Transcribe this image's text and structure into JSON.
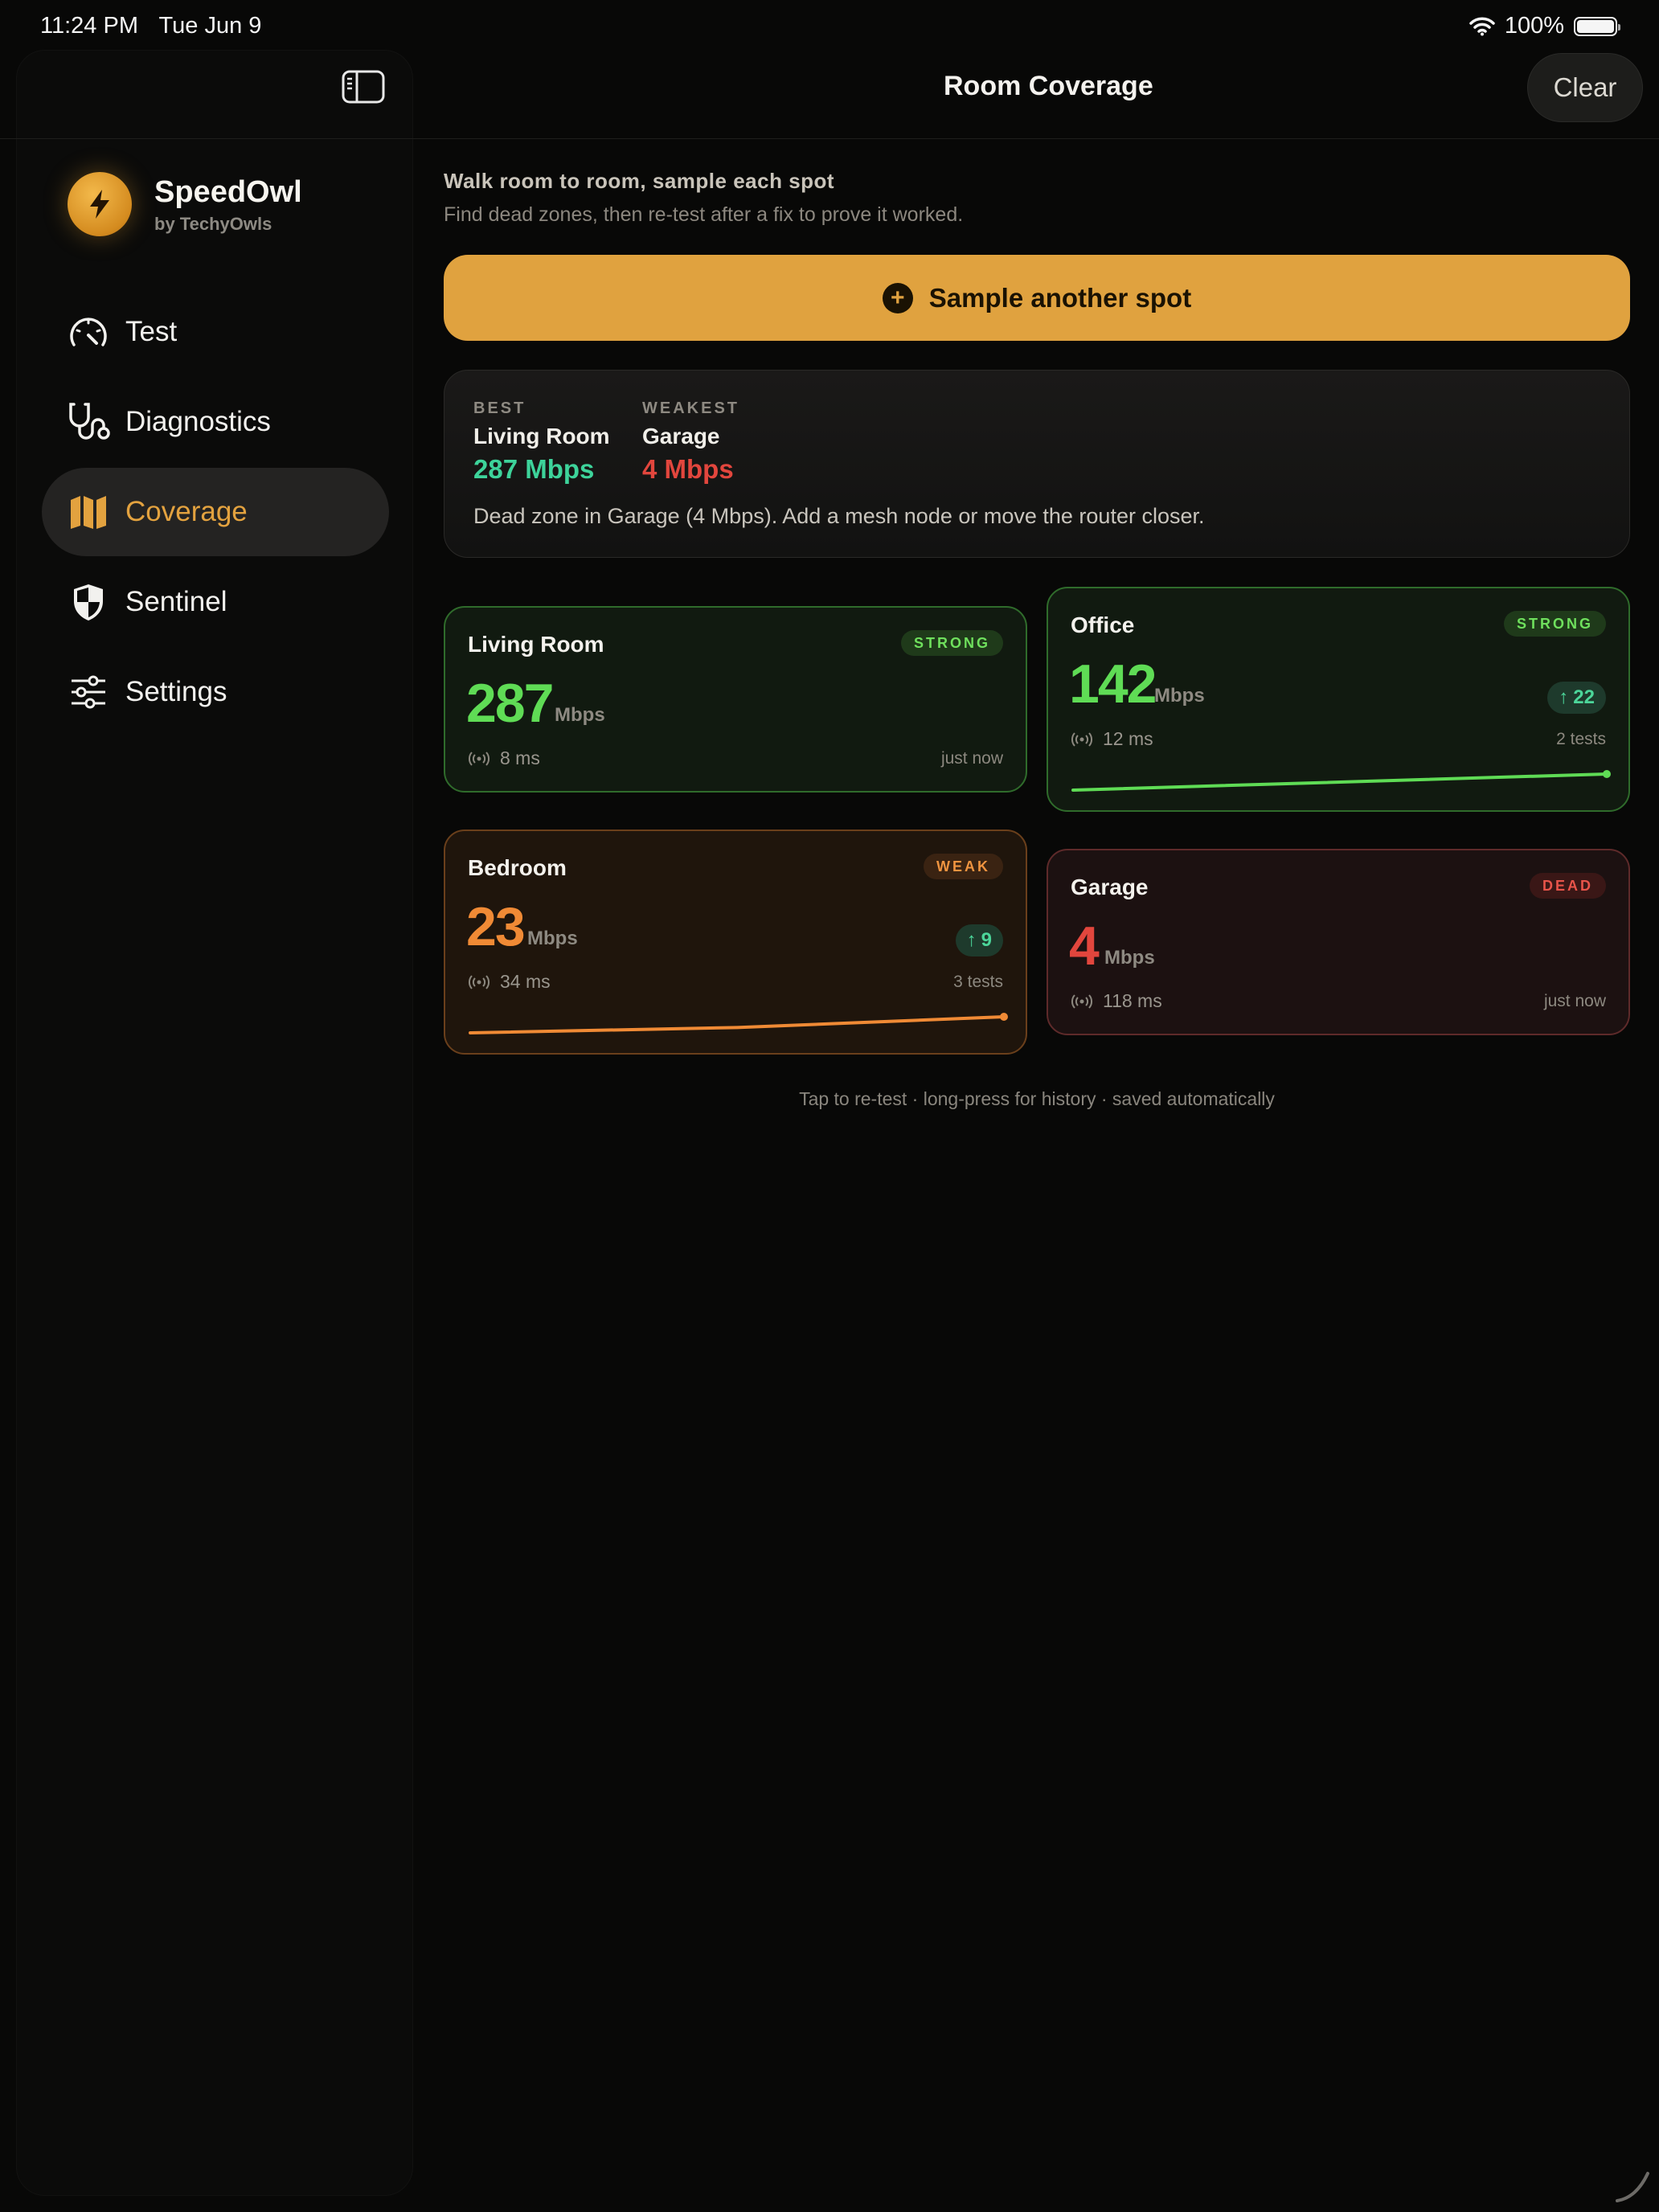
{
  "status_bar": {
    "time": "11:24 PM",
    "date": "Tue Jun 9",
    "battery": "100%"
  },
  "sidebar": {
    "app_name": "SpeedOwl",
    "app_by": "by TechyOwls",
    "items": [
      {
        "label": "Test",
        "icon": "speedometer-icon"
      },
      {
        "label": "Diagnostics",
        "icon": "stethoscope-icon"
      },
      {
        "label": "Coverage",
        "icon": "map-icon",
        "active": true
      },
      {
        "label": "Sentinel",
        "icon": "shield-icon"
      },
      {
        "label": "Settings",
        "icon": "sliders-icon"
      }
    ]
  },
  "header": {
    "title": "Room Coverage",
    "clear_label": "Clear"
  },
  "intro": {
    "title": "Walk room to room, sample each spot",
    "subtitle": "Find dead zones, then re-test after a fix to prove it worked."
  },
  "sample_button": {
    "label": "Sample another spot"
  },
  "summary": {
    "best_label": "BEST",
    "best_room": "Living Room",
    "best_value": "287 Mbps",
    "weakest_label": "WEAKEST",
    "weakest_room": "Garage",
    "weakest_value": "4 Mbps",
    "note": "Dead zone in Garage (4 Mbps). Add a mesh node or move the router closer."
  },
  "rooms": [
    {
      "name": "Living Room",
      "badge": "STRONG",
      "speed": "287",
      "unit": "Mbps",
      "ping": "8 ms",
      "when": "just now",
      "color": "#5fdc55"
    },
    {
      "name": "Office",
      "badge": "STRONG",
      "speed": "142",
      "unit": "Mbps",
      "ping": "12 ms",
      "tests": "2 tests",
      "delta": "22",
      "color": "#5fdc55",
      "trend": [
        120,
        142
      ]
    },
    {
      "name": "Bedroom",
      "badge": "WEAK",
      "speed": "23",
      "unit": "Mbps",
      "ping": "34 ms",
      "tests": "3 tests",
      "delta": "9",
      "color": "#f08a35",
      "trend": [
        14,
        17,
        23
      ]
    },
    {
      "name": "Garage",
      "badge": "DEAD",
      "speed": "4",
      "unit": "Mbps",
      "ping": "118 ms",
      "when": "just now",
      "color": "#e2463d"
    }
  ],
  "footer": "Tap to re-test · long-press for history · saved automatically",
  "colors": {
    "accent": "#e0a23f",
    "strong": "#5fdc55",
    "weak": "#f08a35",
    "dead": "#e2463d",
    "best_value": "#3dd39a"
  }
}
